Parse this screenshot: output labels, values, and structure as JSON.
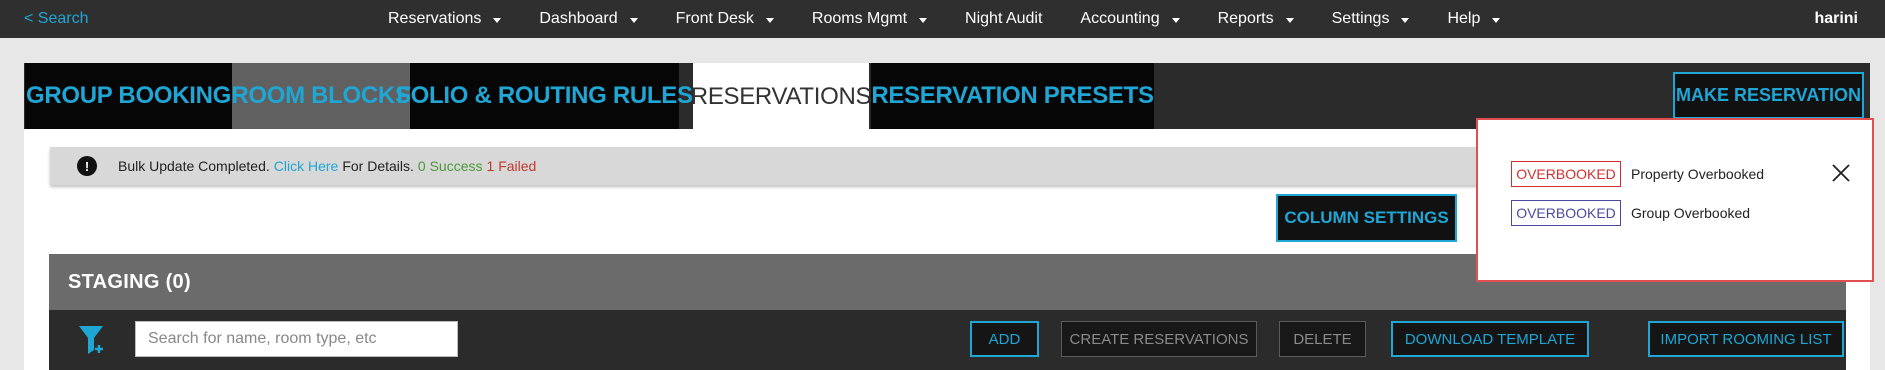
{
  "topnav": {
    "search_label": "< Search",
    "items": [
      {
        "label": "Reservations",
        "dropdown": true
      },
      {
        "label": "Dashboard",
        "dropdown": true
      },
      {
        "label": "Front Desk",
        "dropdown": true
      },
      {
        "label": "Rooms Mgmt",
        "dropdown": true
      },
      {
        "label": "Night Audit",
        "dropdown": false
      },
      {
        "label": "Accounting",
        "dropdown": true
      },
      {
        "label": "Reports",
        "dropdown": true
      },
      {
        "label": "Settings",
        "dropdown": true
      },
      {
        "label": "Help",
        "dropdown": true
      }
    ],
    "user": "harini"
  },
  "tabs": [
    {
      "label": "GROUP BOOKING"
    },
    {
      "label": "ROOM BLOCKS"
    },
    {
      "label": "FOLIO & ROUTING RULES"
    },
    {
      "label": "RESERVATIONS",
      "active": true
    },
    {
      "label": "RESERVATION PRESETS"
    }
  ],
  "actions": {
    "make_reservation": "MAKE RESERVATION",
    "column_settings": "COLUMN SETTINGS"
  },
  "notice": {
    "icon": "warning-icon",
    "prefix": "Bulk Update Completed.",
    "link": "Click Here",
    "middle": "For Details.",
    "success": "0 Success",
    "failed": "1 Failed"
  },
  "staging": {
    "title": "STAGING (0)",
    "search_placeholder": "Search for name, room type, etc",
    "buttons": {
      "add": "ADD",
      "create": "CREATE RESERVATIONS",
      "delete": "DELETE",
      "download": "DOWNLOAD TEMPLATE",
      "import": "IMPORT ROOMING LIST"
    }
  },
  "legend": {
    "items": [
      {
        "badge": "OVERBOOKED",
        "label": "Property Overbooked",
        "color": "#d23030"
      },
      {
        "badge": "OVERBOOKED",
        "label": "Group Overbooked",
        "color": "#4a4aa0"
      }
    ]
  },
  "colors": {
    "accent": "#1fa6d4",
    "navbar": "#2f2f2f",
    "success": "#4a9a3a",
    "failed": "#c0392b"
  }
}
